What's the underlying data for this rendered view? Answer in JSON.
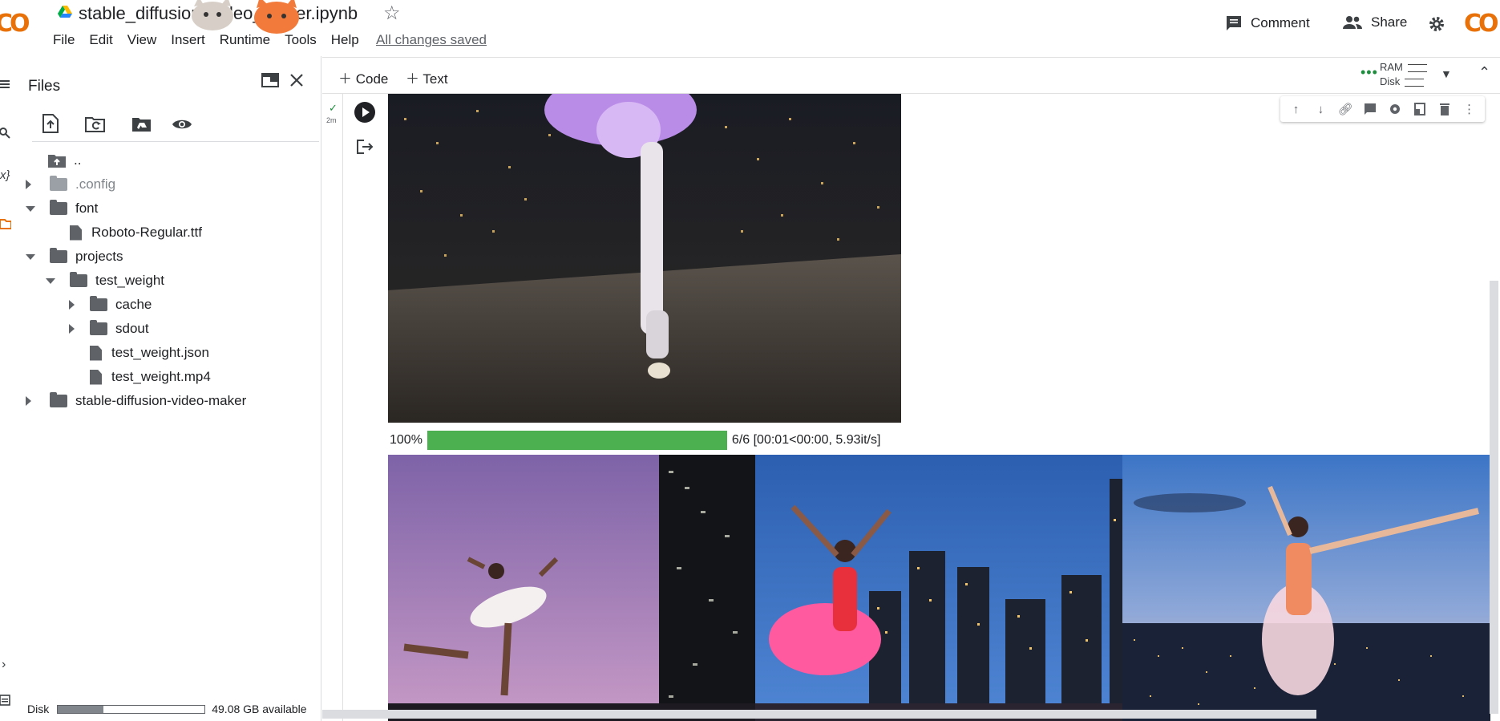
{
  "header": {
    "logo_text": "CO",
    "notebook_title": "stable_diffusion_video_maker.ipynb",
    "menu": [
      "File",
      "Edit",
      "View",
      "Insert",
      "Runtime",
      "Tools",
      "Help"
    ],
    "save_status": "All changes saved",
    "comment_label": "Comment",
    "share_label": "Share"
  },
  "toolbar": {
    "add_code": "Code",
    "add_text": "Text",
    "ram_label": "RAM",
    "disk_label": "Disk"
  },
  "files_panel": {
    "title": "Files",
    "tree": [
      {
        "label": "..",
        "type": "up"
      },
      {
        "label": ".config",
        "type": "folder"
      },
      {
        "label": "font",
        "type": "folder"
      },
      {
        "label": "Roboto-Regular.ttf",
        "type": "file"
      },
      {
        "label": "projects",
        "type": "folder"
      },
      {
        "label": "test_weight",
        "type": "folder"
      },
      {
        "label": "cache",
        "type": "folder"
      },
      {
        "label": "sdout",
        "type": "folder"
      },
      {
        "label": "test_weight.json",
        "type": "file"
      },
      {
        "label": "test_weight.mp4",
        "type": "file"
      },
      {
        "label": "stable-diffusion-video-maker",
        "type": "folder"
      }
    ],
    "disk_label": "Disk",
    "disk_available": "49.08 GB available",
    "disk_used_fraction": 0.31
  },
  "cell": {
    "exec_time": "2m",
    "progress_percent": "100%",
    "progress_fraction": 1.0,
    "progress_stats": "6/6 [00:01<00:00, 5.93it/s]"
  },
  "colors": {
    "progress_green": "#4caf50",
    "logo_yellow": "#f9ab00",
    "logo_orange": "#e8710a"
  }
}
